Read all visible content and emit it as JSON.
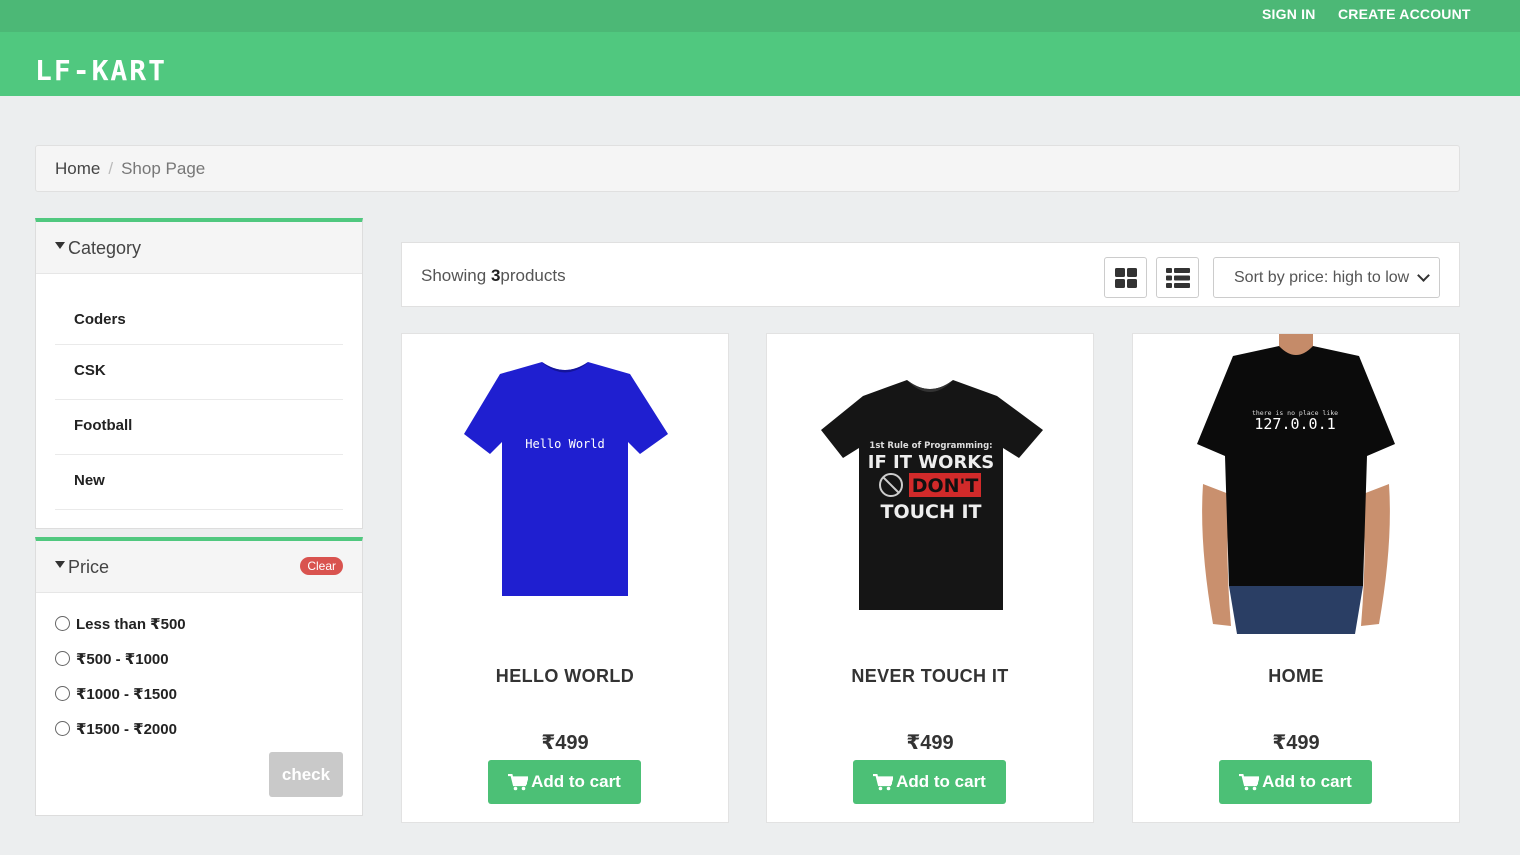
{
  "topbar": {
    "sign_in": "SIGN IN",
    "create_account": "CREATE ACCOUNT"
  },
  "header": {
    "logo": "LF-KART"
  },
  "breadcrumb": {
    "home": "Home",
    "separator": "/",
    "current": "Shop Page"
  },
  "category_panel": {
    "title": "Category",
    "items": [
      {
        "label": "Coders"
      },
      {
        "label": "CSK"
      },
      {
        "label": "Football"
      },
      {
        "label": "New"
      }
    ]
  },
  "price_panel": {
    "title": "Price",
    "clear_label": "Clear",
    "options": [
      {
        "label": "Less than ₹500"
      },
      {
        "label": "₹500 - ₹1000"
      },
      {
        "label": "₹1000 - ₹1500"
      },
      {
        "label": "₹1500 - ₹2000"
      }
    ],
    "check_label": "check"
  },
  "toolbar": {
    "showing_prefix": "Showing ",
    "count": "3",
    "showing_suffix": "products",
    "sort_selected": "Sort by price: high to low"
  },
  "products": [
    {
      "name": "HELLO WORLD",
      "price": "₹499",
      "button": "Add to cart",
      "shirt_text": "Hello World",
      "shirt_color": "#1f1fd0"
    },
    {
      "name": "NEVER TOUCH IT",
      "price": "₹499",
      "button": "Add to cart",
      "shirt_line1": "1st Rule of Programming:",
      "shirt_line2": "IF IT WORKS",
      "shirt_line3": "DON'T",
      "shirt_line4": "TOUCH IT"
    },
    {
      "name": "HOME",
      "price": "₹499",
      "button": "Add to cart",
      "shirt_small": "there is no place like",
      "shirt_big": "127.0.0.1"
    }
  ],
  "colors": {
    "topbar": "#4cb876",
    "header": "#50c87f",
    "button": "#4cc076",
    "clear_badge": "#d9534f"
  }
}
